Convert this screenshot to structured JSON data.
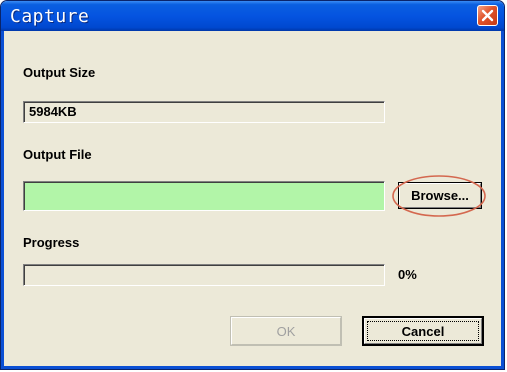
{
  "window": {
    "title": "Capture"
  },
  "output_size": {
    "label": "Output Size",
    "value": "5984KB"
  },
  "output_file": {
    "label": "Output File",
    "value": "",
    "browse_label": "Browse..."
  },
  "progress": {
    "label": "Progress",
    "fraction": 0,
    "percent_text": "0%"
  },
  "buttons": {
    "ok_label": "OK",
    "cancel_label": "Cancel"
  },
  "colors": {
    "file_field_bg": "#b2f5a8",
    "highlight_ring": "#d4684f"
  }
}
